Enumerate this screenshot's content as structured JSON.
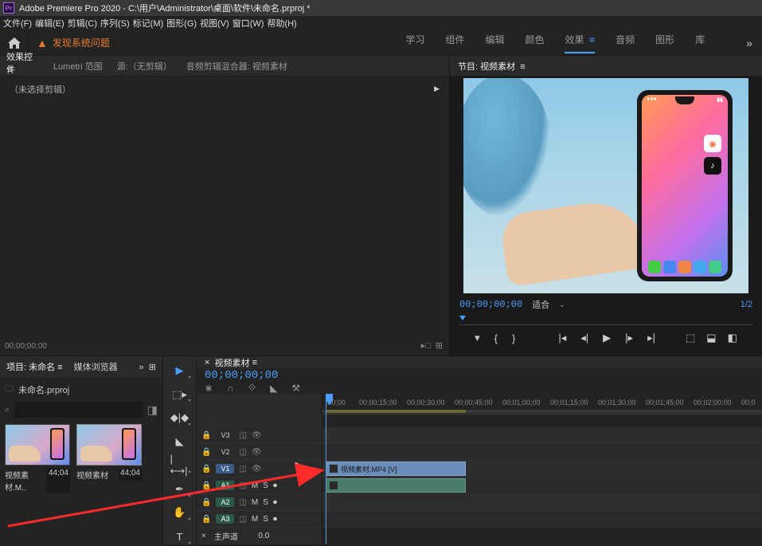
{
  "titlebar": {
    "app": "Adobe Premiere Pro 2020",
    "path": "C:\\用户\\Administrator\\桌面\\软件\\未命名.prproj *"
  },
  "menubar": {
    "file": "文件(F)",
    "edit": "编辑(E)",
    "clip": "剪辑(C)",
    "sequence": "序列(S)",
    "markers": "标记(M)",
    "graphics": "图形(G)",
    "view": "视图(V)",
    "window": "窗口(W)",
    "help": "帮助(H)"
  },
  "workspace": {
    "warning": "发现系统问题",
    "tabs": {
      "learn": "学习",
      "assembly": "组件",
      "editing": "编辑",
      "color": "颜色",
      "effects": "效果",
      "audio": "音频",
      "graphics": "图形",
      "library": "库"
    }
  },
  "effect_panel": {
    "tab_effect_controls": "效果控件",
    "tab_lumetri": "Lumetri 范围",
    "tab_source": "源:（无剪辑）",
    "tab_audio_mixer": "音频剪辑混合器: 视频素材",
    "no_clip": "（未选择剪辑）",
    "timecode": "00;00;00;00"
  },
  "program": {
    "title": "节目: 视频素材",
    "timecode": "00;00;00;00",
    "fit": "适合",
    "resolution": "1/2"
  },
  "project": {
    "tab_project": "项目: 未命名",
    "tab_media_browser": "媒体浏览器",
    "bin_name": "未命名.prproj",
    "search_placeholder": "",
    "clips": [
      {
        "name": "视频素材.M..",
        "duration": "44;04"
      },
      {
        "name": "视频素材",
        "duration": "44;04"
      }
    ]
  },
  "timeline": {
    "sequence_name": "视频素材",
    "timecode": "00;00;00;00",
    "ruler": [
      ";00;00",
      "00;00;15;00",
      "00;00;30;00",
      "00;00;45;00",
      "00;01;00;00",
      "00;01;15;00",
      "00;01;30;00",
      "00;01;45;00",
      "00;02;00;00",
      "00;0"
    ],
    "tracks": {
      "v3": "V3",
      "v2": "V2",
      "v1": "V1",
      "a1": "A1",
      "a2": "A2",
      "a3": "A3"
    },
    "clip_label": "视频素材.MP4 [V]",
    "master": "主声道",
    "master_val": "0.0"
  }
}
